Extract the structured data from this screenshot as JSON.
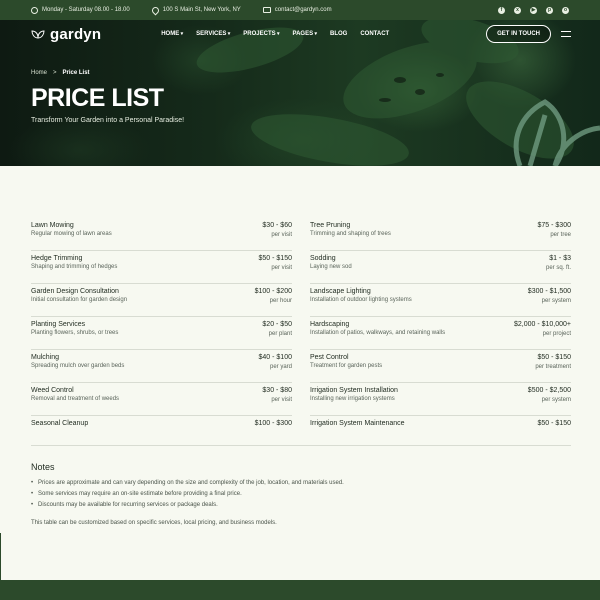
{
  "topbar": {
    "hours": "Monday - Saturday 08.00 - 18.00",
    "address": "100 S Main St, New York, NY",
    "email": "contact@gardyn.com",
    "socials": [
      "facebook-icon",
      "x-icon",
      "youtube-icon",
      "pinterest-icon",
      "instagram-icon"
    ]
  },
  "header": {
    "logo": "gardyn",
    "menu": [
      {
        "label": "HOME",
        "dropdown": true
      },
      {
        "label": "SERVICES",
        "dropdown": true
      },
      {
        "label": "PROJECTS",
        "dropdown": true
      },
      {
        "label": "PAGES",
        "dropdown": true
      },
      {
        "label": "BLOG",
        "dropdown": false
      },
      {
        "label": "CONTACT",
        "dropdown": false
      }
    ],
    "cta": "GET IN TOUCH"
  },
  "hero": {
    "breadcrumb": {
      "home": "Home",
      "separator": ">",
      "current": "Price List"
    },
    "title": "PRICE LIST",
    "subtitle": "Transform Your Garden into a Personal Paradise!"
  },
  "prices": {
    "left": [
      {
        "name": "Lawn Mowing",
        "price": "$30 - $60",
        "desc": "Regular mowing of lawn areas",
        "unit": "per visit"
      },
      {
        "name": "Hedge Trimming",
        "price": "$50 - $150",
        "desc": "Shaping and trimming of hedges",
        "unit": "per visit"
      },
      {
        "name": "Garden Design Consultation",
        "price": "$100 - $200",
        "desc": "Initial consultation for garden design",
        "unit": "per hour"
      },
      {
        "name": "Planting Services",
        "price": "$20 - $50",
        "desc": "Planting flowers, shrubs, or trees",
        "unit": "per plant"
      },
      {
        "name": "Mulching",
        "price": "$40 - $100",
        "desc": "Spreading mulch over garden beds",
        "unit": "per yard"
      },
      {
        "name": "Weed Control",
        "price": "$30 - $80",
        "desc": "Removal and treatment of weeds",
        "unit": "per visit"
      },
      {
        "name": "Seasonal Cleanup",
        "price": "$100 - $300",
        "desc": "",
        "unit": ""
      }
    ],
    "right": [
      {
        "name": "Tree Pruning",
        "price": "$75 - $300",
        "desc": "Trimming and shaping of trees",
        "unit": "per tree"
      },
      {
        "name": "Sodding",
        "price": "$1 - $3",
        "desc": "Laying new sod",
        "unit": "per sq. ft."
      },
      {
        "name": "Landscape Lighting",
        "price": "$300 - $1,500",
        "desc": "Installation of outdoor lighting systems",
        "unit": "per system"
      },
      {
        "name": "Hardscaping",
        "price": "$2,000 - $10,000+",
        "desc": "Installation of patios, walkways, and retaining walls",
        "unit": "per project"
      },
      {
        "name": "Pest Control",
        "price": "$50 - $150",
        "desc": "Treatment for garden pests",
        "unit": "per treatment"
      },
      {
        "name": "Irrigation System Installation",
        "price": "$500 - $2,500",
        "desc": "Installing new irrigation systems",
        "unit": "per system"
      },
      {
        "name": "Irrigation System Maintenance",
        "price": "$50 - $150",
        "desc": "",
        "unit": ""
      }
    ]
  },
  "notes": {
    "title": "Notes",
    "items": [
      "Prices are approximate and can vary depending on the size and complexity of the job, location, and materials used.",
      "Some services may require an on-site estimate before providing a final price.",
      "Discounts may be available for recurring services or package deals."
    ],
    "footer": "This table can be customized based on specific services, local pricing, and business models."
  },
  "colors": {
    "brand_green": "#2c4a2b",
    "background": "#f7f9f1",
    "text": "#1f2a1f"
  }
}
